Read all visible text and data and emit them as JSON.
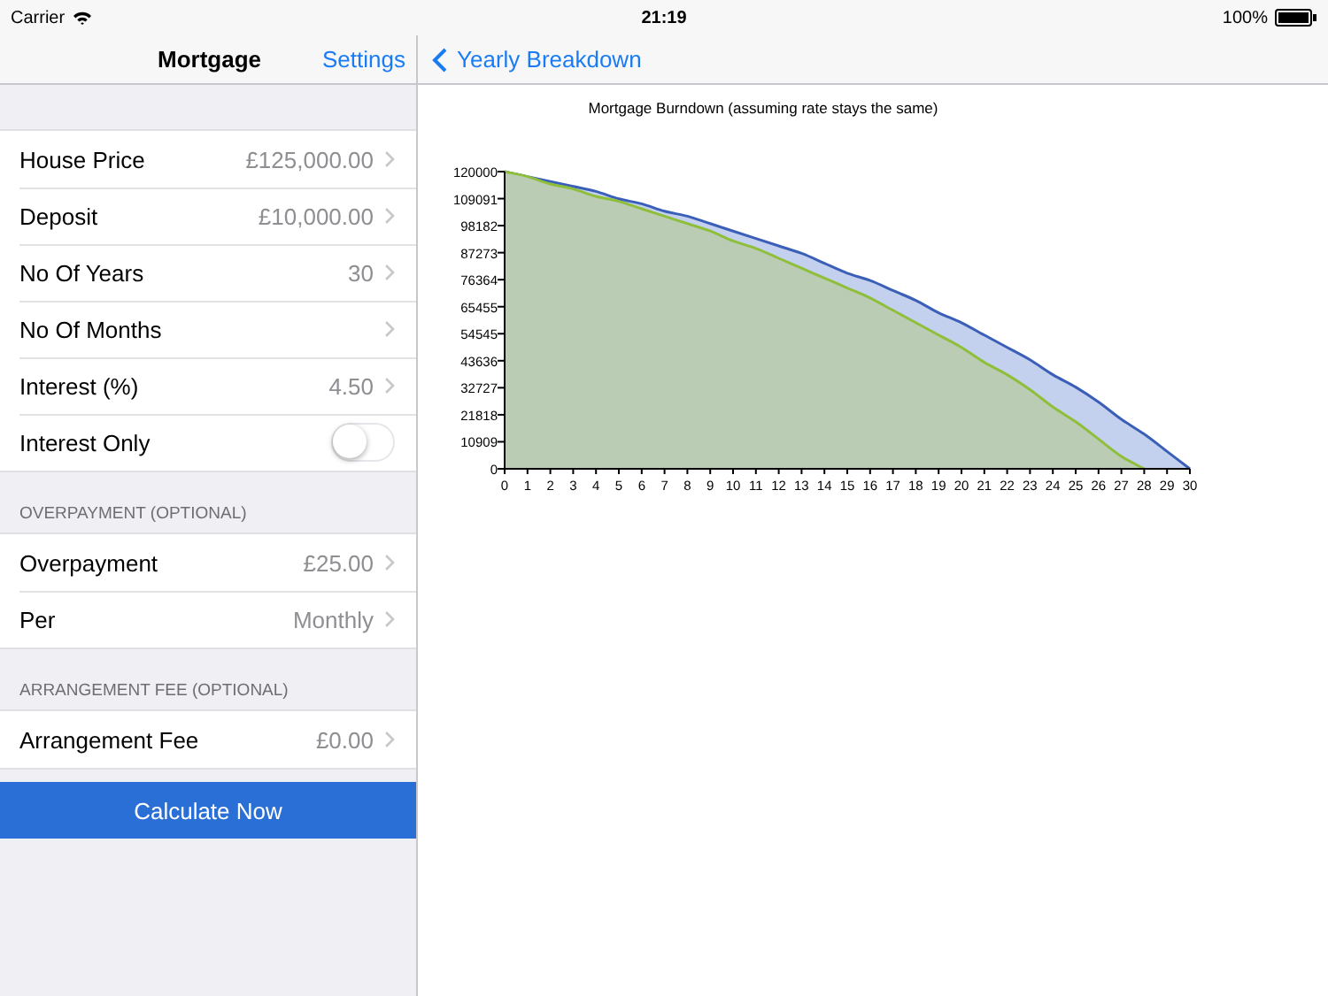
{
  "status_bar": {
    "carrier": "Carrier",
    "time": "21:19",
    "battery": "100%"
  },
  "master": {
    "title": "Mortgage",
    "action": "Settings",
    "sections": [
      {
        "rows": [
          {
            "kind": "value",
            "label": "House Price",
            "value": "£125,000.00"
          },
          {
            "kind": "value",
            "label": "Deposit",
            "value": "£10,000.00"
          },
          {
            "kind": "value",
            "label": "No Of Years",
            "value": "30"
          },
          {
            "kind": "value",
            "label": "No Of Months"
          },
          {
            "kind": "value",
            "label": "Interest (%)",
            "value": "4.50"
          },
          {
            "kind": "toggle",
            "label": "Interest Only",
            "on": false
          }
        ]
      },
      {
        "header": "OVERPAYMENT (OPTIONAL)",
        "rows": [
          {
            "kind": "value",
            "label": "Overpayment",
            "value": "£25.00"
          },
          {
            "kind": "value",
            "label": "Per",
            "value": "Monthly"
          }
        ]
      },
      {
        "header": "ARRANGEMENT FEE (OPTIONAL)",
        "rows": [
          {
            "kind": "value",
            "label": "Arrangement Fee",
            "value": "£0.00"
          }
        ]
      }
    ],
    "button": "Calculate Now"
  },
  "detail": {
    "back": "Yearly Breakdown",
    "chart_data": {
      "type": "area",
      "title": "Mortgage Burndown (assuming rate stays the same)",
      "x": [
        0,
        1,
        2,
        3,
        4,
        5,
        6,
        7,
        8,
        9,
        10,
        11,
        12,
        13,
        14,
        15,
        16,
        17,
        18,
        19,
        20,
        21,
        22,
        23,
        24,
        25,
        26,
        27,
        28,
        29,
        30
      ],
      "series": [
        {
          "color": "#3b5fb8",
          "values": [
            120000,
            118000,
            116000,
            114000,
            112000,
            109000,
            107000,
            104000,
            102000,
            99000,
            96000,
            93000,
            90000,
            87000,
            83000,
            79000,
            76000,
            72000,
            68000,
            63000,
            59000,
            54000,
            49000,
            44000,
            38000,
            33000,
            27000,
            20000,
            14000,
            7000,
            0
          ]
        },
        {
          "color": "#8fbf3a",
          "values": [
            120000,
            118000,
            115000,
            113000,
            110000,
            108000,
            105000,
            102000,
            99000,
            96000,
            92000,
            89000,
            85000,
            81000,
            77000,
            73000,
            69000,
            64000,
            59000,
            54000,
            49000,
            43000,
            38000,
            32000,
            25000,
            19000,
            12000,
            5000,
            0,
            null,
            null
          ]
        }
      ],
      "stacked": false,
      "xlim": [
        0,
        30
      ],
      "ylim": [
        0,
        120000
      ],
      "xticks": [
        0,
        1,
        2,
        3,
        4,
        5,
        6,
        7,
        8,
        9,
        10,
        11,
        12,
        13,
        14,
        15,
        16,
        17,
        18,
        19,
        20,
        21,
        22,
        23,
        24,
        25,
        26,
        27,
        28,
        29,
        30
      ],
      "yticks": [
        {
          "value": 0,
          "label": "0"
        },
        {
          "value": 10909.09,
          "label": "10909"
        },
        {
          "value": 21818.18,
          "label": "21818"
        },
        {
          "value": 32727.27,
          "label": "32727"
        },
        {
          "value": 43636.36,
          "label": "43636"
        },
        {
          "value": 54545.45,
          "label": "54545"
        },
        {
          "value": 65454.55,
          "label": "65455"
        },
        {
          "value": 76363.64,
          "label": "76364"
        },
        {
          "value": 87272.73,
          "label": "87273"
        },
        {
          "value": 98181.82,
          "label": "98182"
        },
        {
          "value": 109090.91,
          "label": "109091"
        },
        {
          "value": 120000,
          "label": "120000"
        }
      ]
    }
  }
}
